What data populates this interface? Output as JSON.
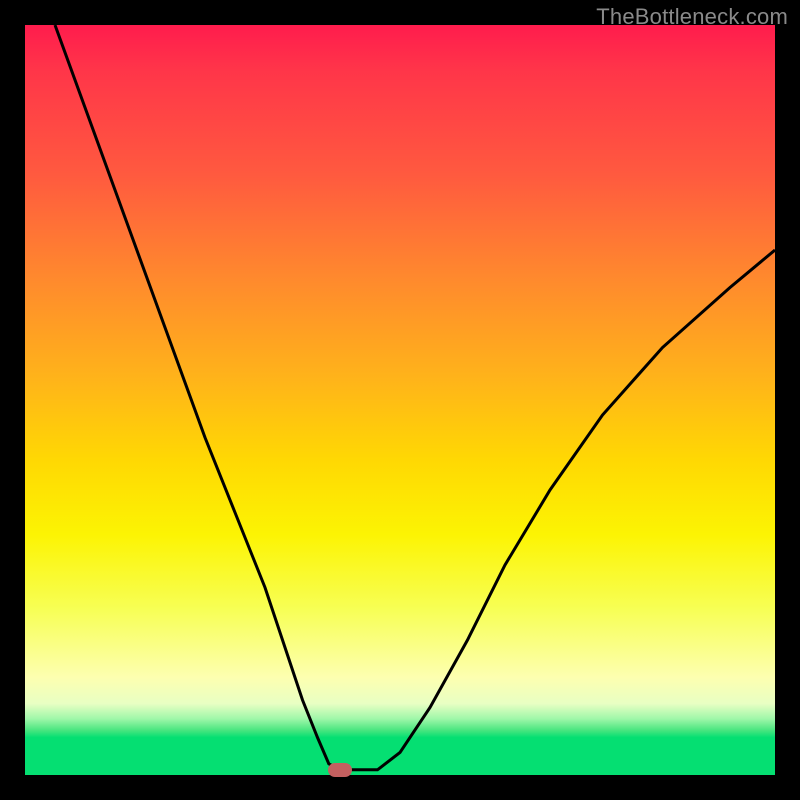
{
  "watermark": {
    "text": "TheBottleneck.com"
  },
  "chart_data": {
    "type": "line",
    "title": "",
    "xlabel": "",
    "ylabel": "",
    "xlim": [
      0,
      100
    ],
    "ylim": [
      0,
      100
    ],
    "grid": false,
    "legend": false,
    "gradient_stops": [
      {
        "pos": 0,
        "color": "#ff1c4d"
      },
      {
        "pos": 6,
        "color": "#ff3549"
      },
      {
        "pos": 20,
        "color": "#ff5a3f"
      },
      {
        "pos": 34,
        "color": "#ff8a2d"
      },
      {
        "pos": 47,
        "color": "#ffb31a"
      },
      {
        "pos": 58,
        "color": "#ffd803"
      },
      {
        "pos": 68,
        "color": "#fcf403"
      },
      {
        "pos": 78,
        "color": "#f7ff56"
      },
      {
        "pos": 87,
        "color": "#fdffb0"
      },
      {
        "pos": 90.5,
        "color": "#e8ffc3"
      },
      {
        "pos": 92.5,
        "color": "#9ff7a9"
      },
      {
        "pos": 94,
        "color": "#4be680"
      },
      {
        "pos": 95,
        "color": "#05df72"
      },
      {
        "pos": 100,
        "color": "#05df72"
      }
    ],
    "series": [
      {
        "name": "bottleneck-curve",
        "x": [
          4,
          8,
          12,
          16,
          20,
          24,
          28,
          32,
          35,
          37,
          39,
          40.5,
          42,
          43,
          47,
          50,
          54,
          59,
          64,
          70,
          77,
          85,
          94,
          100
        ],
        "y": [
          100,
          89,
          78,
          67,
          56,
          45,
          35,
          25,
          16,
          10,
          5,
          1.5,
          0.7,
          0.7,
          0.7,
          3,
          9,
          18,
          28,
          38,
          48,
          57,
          65,
          70
        ]
      }
    ],
    "marker": {
      "x": 42,
      "y": 0.7,
      "color": "#c46060"
    },
    "curve_stroke": "#000000",
    "curve_width": 3
  }
}
